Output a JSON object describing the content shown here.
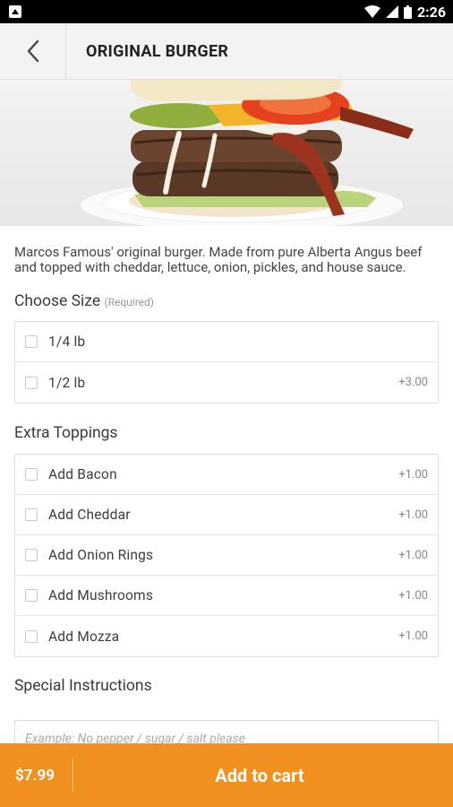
{
  "status_bar": {
    "time": "2:26"
  },
  "header": {
    "title": "ORIGINAL BURGER"
  },
  "description": "Marcos Famous' original burger. Made from pure Alberta Angus beef and topped with cheddar, lettuce, onion, pickles, and house sauce.",
  "size_section": {
    "title": "Choose Size",
    "required_label": "(Required)",
    "options": [
      {
        "label": "1/4 lb",
        "price": ""
      },
      {
        "label": "1/2 lb",
        "price": "+3.00"
      }
    ]
  },
  "toppings_section": {
    "title": "Extra Toppings",
    "options": [
      {
        "label": "Add Bacon",
        "price": "+1.00"
      },
      {
        "label": "Add Cheddar",
        "price": "+1.00"
      },
      {
        "label": "Add Onion Rings",
        "price": "+1.00"
      },
      {
        "label": "Add Mushrooms",
        "price": "+1.00"
      },
      {
        "label": "Add Mozza",
        "price": "+1.00"
      }
    ]
  },
  "instructions": {
    "title": "Special Instructions",
    "placeholder": "Example: No pepper / sugar / salt please"
  },
  "bottom_bar": {
    "price": "$7.99",
    "cta": "Add to cart"
  },
  "colors": {
    "accent": "#f0901f"
  }
}
